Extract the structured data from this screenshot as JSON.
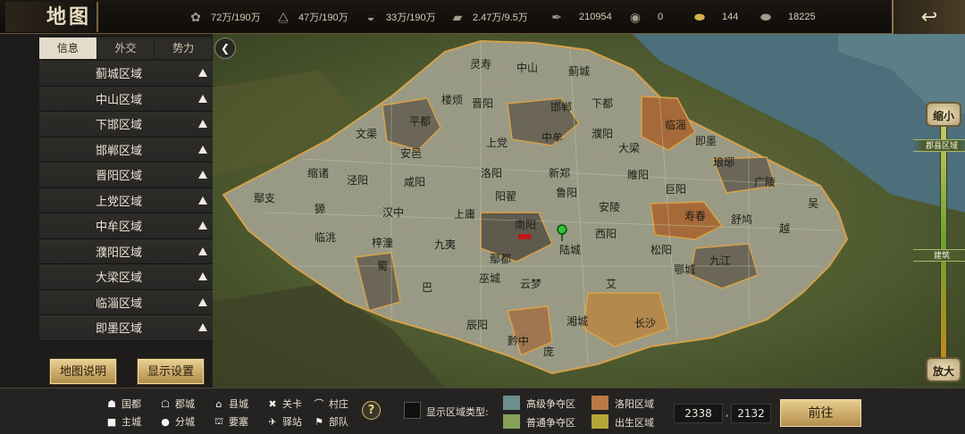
{
  "title": "地图",
  "resources": [
    {
      "icon": "wheat-icon",
      "value": "72万/190万"
    },
    {
      "icon": "wood-icon",
      "value": "47万/190万"
    },
    {
      "icon": "stone-icon",
      "value": "33万/190万"
    },
    {
      "icon": "iron-icon",
      "value": "2.47万/9.5万"
    },
    {
      "icon": "decree-icon",
      "value": "210954"
    },
    {
      "icon": "coin-icon",
      "value": "0"
    },
    {
      "icon": "gold-ingot-icon",
      "value": "144"
    },
    {
      "icon": "silver-icon",
      "value": "18225"
    }
  ],
  "tabs": [
    "信息",
    "外交",
    "势力"
  ],
  "active_tab": 0,
  "region_list": [
    "蓟城区域",
    "中山区域",
    "下邯区域",
    "邯郸区域",
    "晋阳区域",
    "上党区域",
    "中牟区域",
    "濮阳区域",
    "大梁区域",
    "临淄区域",
    "即墨区域"
  ],
  "buttons": {
    "map_help": "地图说明",
    "display_settings": "显示设置",
    "go": "前往"
  },
  "zoom": {
    "shrink": "缩小",
    "enlarge": "放大",
    "level_county": "郡县区域",
    "level_building": "建筑",
    "level": 0.45
  },
  "legend": [
    {
      "glyph": "☗",
      "label": "国都"
    },
    {
      "glyph": "☖",
      "label": "郡城"
    },
    {
      "glyph": "⌂",
      "label": "县城"
    },
    {
      "glyph": "✖",
      "label": "关卡"
    },
    {
      "glyph": "⌒",
      "label": "村庄"
    },
    {
      "glyph": "■",
      "label": "主城"
    },
    {
      "glyph": "●",
      "label": "分城"
    },
    {
      "glyph": "⛫",
      "label": "要塞"
    },
    {
      "glyph": "✈",
      "label": "驿站"
    },
    {
      "glyph": "⚑",
      "label": "部队"
    }
  ],
  "region_type": {
    "label": "显示区域类型:",
    "types": [
      {
        "label": "高级争夺区",
        "color": "#6d8e8c"
      },
      {
        "label": "洛阳区域",
        "color": "#b97a45"
      },
      {
        "label": "普通争夺区",
        "color": "#86a05b"
      },
      {
        "label": "出生区域",
        "color": "#b5a73a"
      }
    ]
  },
  "coords": {
    "x": "2338",
    "y": "2132"
  },
  "map_labels": [
    "灵寿",
    "中山",
    "蓟城",
    "楼烦",
    "晋阳",
    "邯郸",
    "下都",
    "平都",
    "临淄",
    "文渠",
    "上党",
    "中牟",
    "濮阳",
    "即墨",
    "安邑",
    "大梁",
    "琅琊",
    "缩诸",
    "泾阳",
    "咸阳",
    "洛阳",
    "新郑",
    "睢阳",
    "广陵",
    "鄢支",
    "阳翟",
    "鲁阳",
    "巨阳",
    "吴",
    "獂",
    "汉中",
    "上庸",
    "安陵",
    "寿春",
    "舒鸠",
    "临洮",
    "南阳",
    "西阳",
    "越",
    "梓潼",
    "九夷",
    "陆城",
    "松阳",
    "鄢都",
    "九江",
    "蜀",
    "巫城",
    "鄂城",
    "巴",
    "云梦",
    "艾",
    "辰阳",
    "湘城",
    "长沙",
    "黔中",
    "庞"
  ]
}
